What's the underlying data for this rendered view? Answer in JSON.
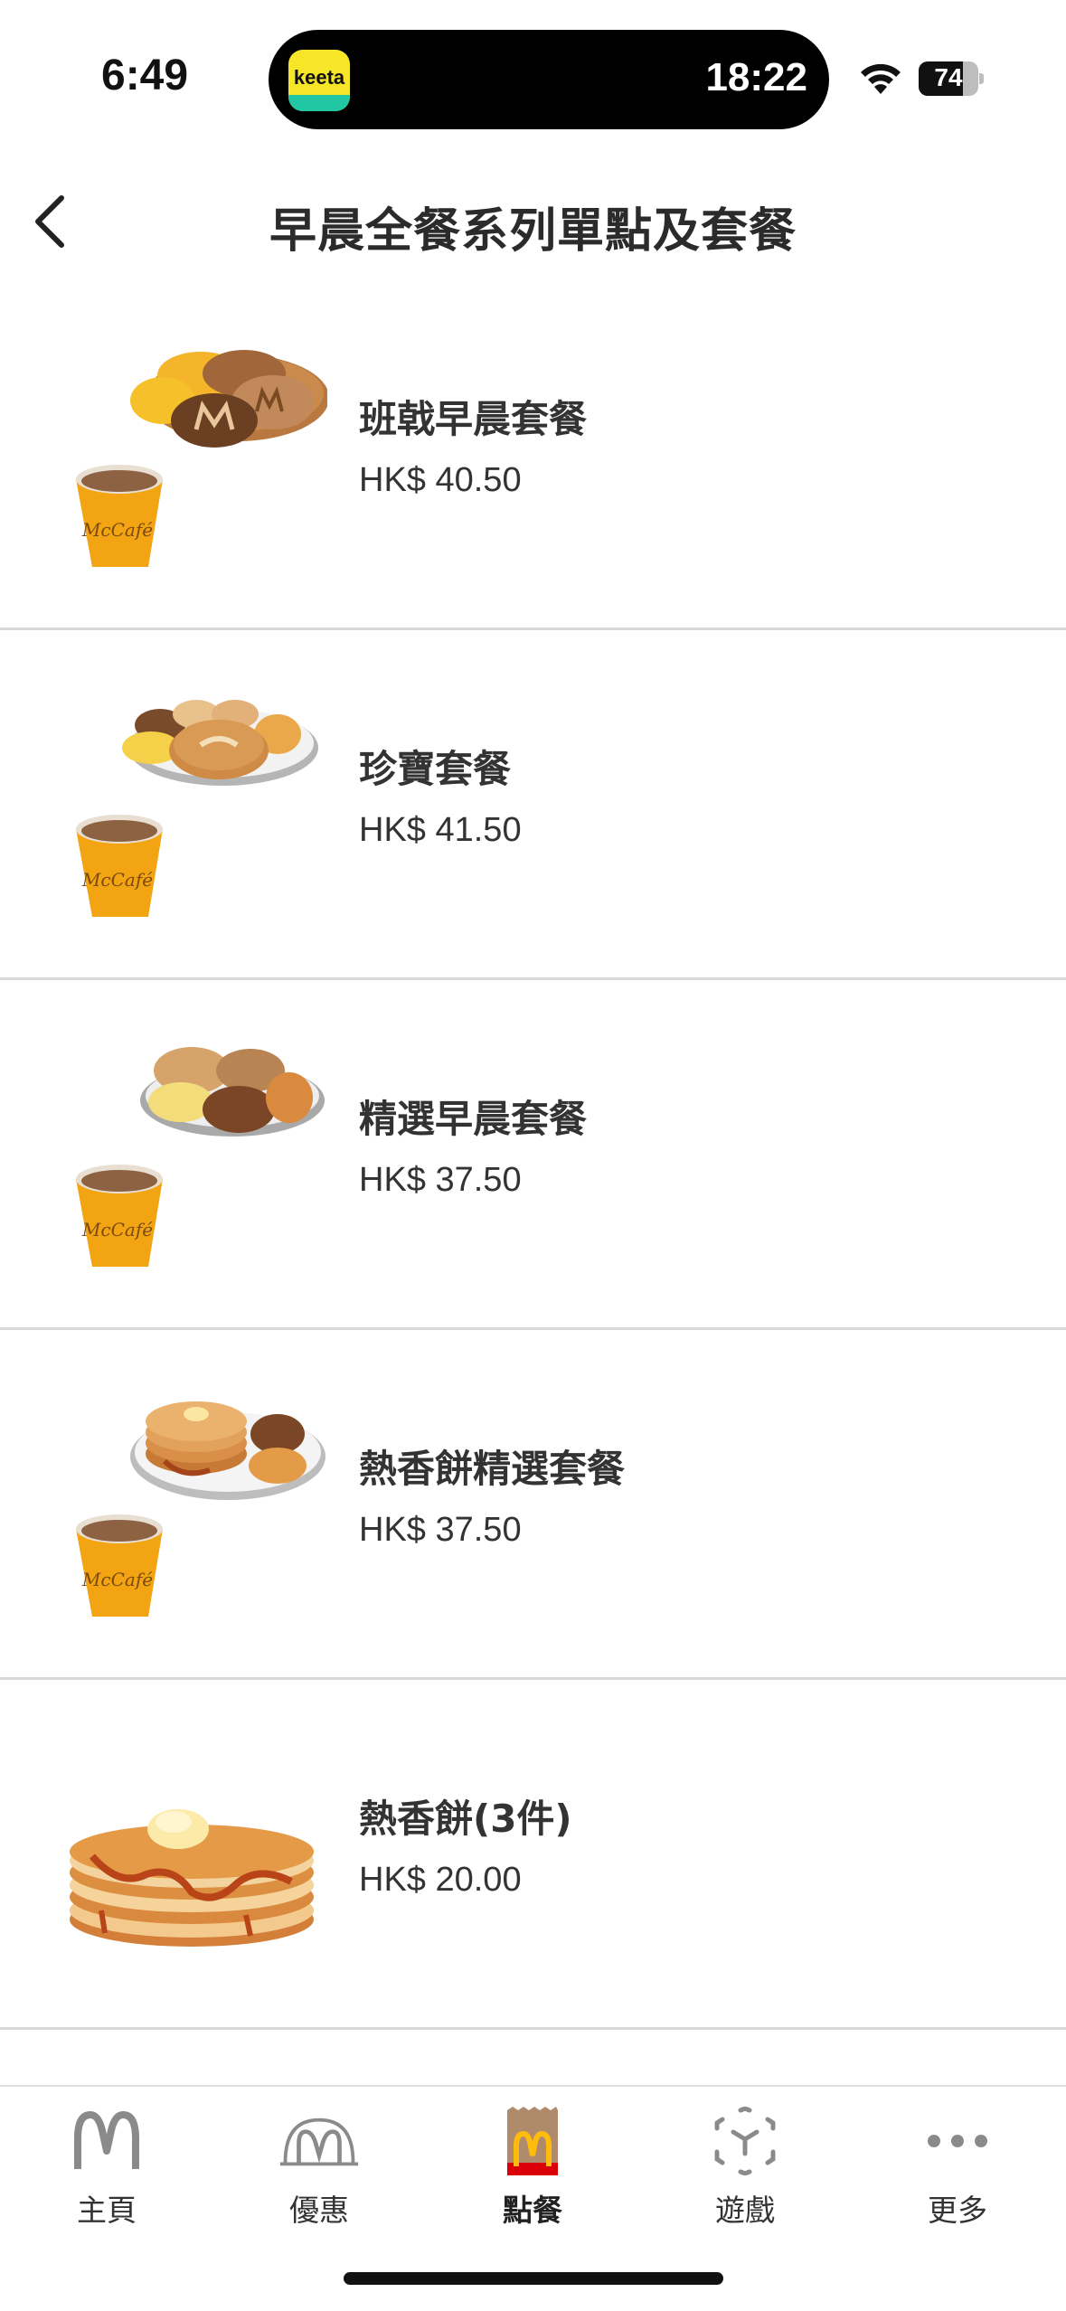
{
  "status_bar": {
    "time": "6:49",
    "island_app_label": "keeta",
    "island_time": "18:22",
    "battery_level": "74",
    "battery_fraction": 0.74
  },
  "header": {
    "title": "早晨全餐系列單點及套餐"
  },
  "items": [
    {
      "name": "班戟早晨套餐",
      "price": "HK$ 40.50",
      "image_kind": "hotcakes-sausage-set-with-coffee"
    },
    {
      "name": "珍寶套餐",
      "price": "HK$ 41.50",
      "image_kind": "big-breakfast-set-with-coffee"
    },
    {
      "name": "精選早晨套餐",
      "price": "HK$ 37.50",
      "image_kind": "breakfast-platter-set-with-coffee"
    },
    {
      "name": "熱香餅精選套餐",
      "price": "HK$ 37.50",
      "image_kind": "hotcakes-platter-set-with-coffee"
    },
    {
      "name": "熱香餅(3件)",
      "price": "HK$ 20.00",
      "image_kind": "hotcakes-stack"
    }
  ],
  "coffee_cup_label": "McCafé",
  "tab_bar": {
    "tabs": [
      {
        "label": "主頁",
        "icon": "golden-arches-icon"
      },
      {
        "label": "優惠",
        "icon": "offers-arches-icon"
      },
      {
        "label": "點餐",
        "icon": "order-bag-icon",
        "active": true
      },
      {
        "label": "遊戲",
        "icon": "game-cube-icon"
      },
      {
        "label": "更多",
        "icon": "more-dots-icon"
      }
    ]
  },
  "colors": {
    "mcd_yellow": "#ffbc0d",
    "mcd_red": "#db0007",
    "divider": "#d9d9d9",
    "text": "#2b2b2b",
    "inactive_icon": "#8a8a8a"
  }
}
